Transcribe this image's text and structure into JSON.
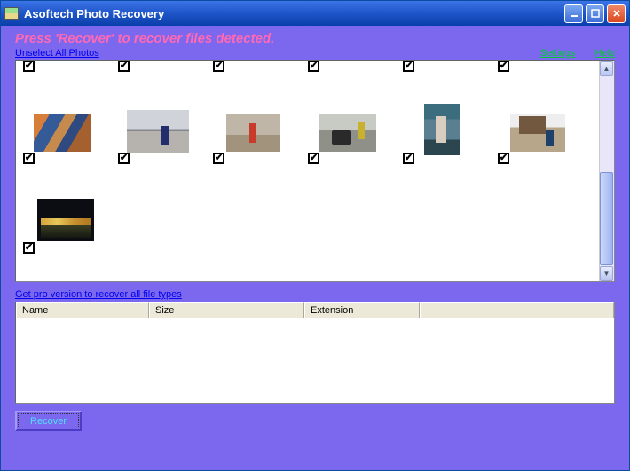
{
  "window": {
    "title": "Asoftech Photo Recovery"
  },
  "instruction": "Press 'Recover' to recover files detected.",
  "links": {
    "unselect": "Unselect All Photos",
    "settings": "Settings",
    "help": "Help",
    "pro": "Get pro version to recover all file types"
  },
  "columns": {
    "name": "Name",
    "size": "Size",
    "extension": "Extension"
  },
  "buttons": {
    "recover": "Recover"
  },
  "checkmark": "✔",
  "photos_row1_count": 6,
  "photos_row2_count": 6,
  "photos_row3_count": 1
}
